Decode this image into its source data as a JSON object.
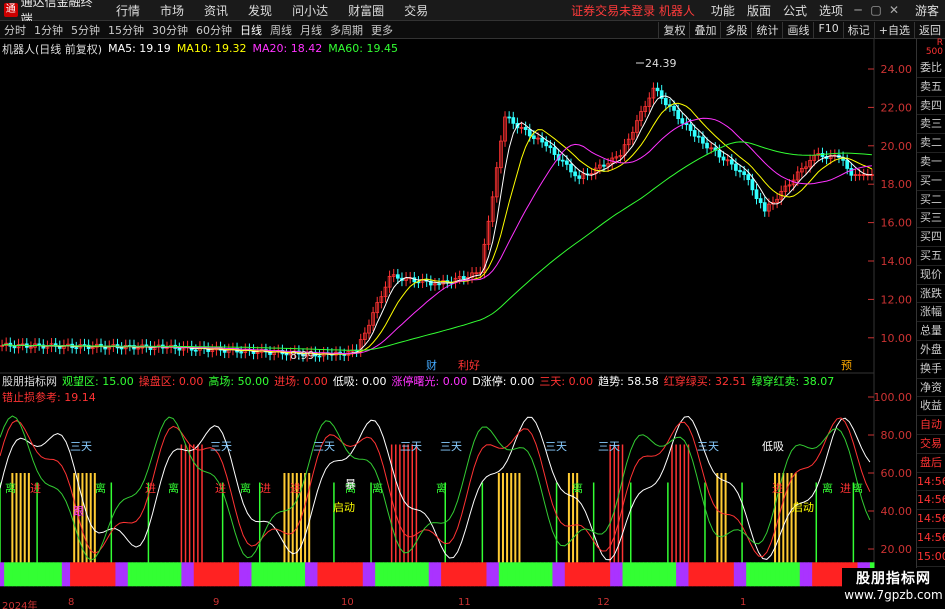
{
  "menubar": {
    "app_title": "通达信金融终端",
    "items": [
      "行情",
      "市场",
      "资讯",
      "发现",
      "问小达",
      "财富圈",
      "交易"
    ],
    "warning": "证券交易未登录  机器人",
    "right_items": [
      "功能",
      "版面",
      "公式",
      "选项"
    ],
    "guest": "游客"
  },
  "periodbar": {
    "periods": [
      "分时",
      "1分钟",
      "5分钟",
      "15分钟",
      "30分钟",
      "60分钟",
      "日线",
      "周线",
      "月线",
      "多周期",
      "更多"
    ],
    "active": "日线",
    "right_buttons": [
      "复权",
      "叠加",
      "多股",
      "统计",
      "画线",
      "F10",
      "标记",
      "+自选",
      "返回"
    ]
  },
  "stock": {
    "name": "机器人(日线 前复权)",
    "ma": [
      {
        "label": "MA5: 19.19",
        "color": "#ffffff"
      },
      {
        "label": "MA10: 19.32",
        "color": "#ffff00"
      },
      {
        "label": "MA20: 18.42",
        "color": "#ff33ff"
      },
      {
        "label": "MA60: 19.45",
        "color": "#33ff33"
      }
    ],
    "high_label": "24.39",
    "low_label": "8.99",
    "markers": [
      "财",
      "利好",
      "预"
    ]
  },
  "price_axis": [
    "24.00",
    "22.00",
    "20.00",
    "18.00",
    "16.00",
    "14.00",
    "12.00",
    "10.00"
  ],
  "indicator": {
    "name": "股朋指标网",
    "fields": [
      {
        "label": "观望区: 15.00",
        "color": "#33ff33"
      },
      {
        "label": "操盘区: 0.00",
        "color": "#ff3333"
      },
      {
        "label": "高场: 50.00",
        "color": "#33ff33"
      },
      {
        "label": "进场: 0.00",
        "color": "#ff3333"
      },
      {
        "label": "低吸: 0.00",
        "color": "#ffffff"
      },
      {
        "label": "涨停曙光: 0.00",
        "color": "#ff33ff"
      },
      {
        "label": "D涨停: 0.00",
        "color": "#ffffff"
      },
      {
        "label": "三天: 0.00",
        "color": "#ff3333"
      },
      {
        "label": "趋势: 58.58",
        "color": "#ffffff"
      },
      {
        "label": "红穿绿买: 32.51",
        "color": "#ff3333"
      },
      {
        "label": "绿穿红卖: 38.07",
        "color": "#33ff33"
      }
    ],
    "line2": "错止损参考: 19.14",
    "axis": [
      "100.00",
      "80.00",
      "60.00",
      "40.00",
      "20.00"
    ],
    "labels": {
      "santian": "三天",
      "li": "离",
      "jin": "进",
      "gen": "跟",
      "qidong": "启动",
      "bao": "暴",
      "xiji": "低吸"
    }
  },
  "sidebar": [
    "委比",
    "卖五",
    "卖四",
    "卖三",
    "卖二",
    "卖一",
    "买一",
    "买二",
    "买三",
    "买四",
    "买五",
    "现价",
    "涨跌",
    "涨幅",
    "总量",
    "外盘",
    "换手",
    "净资",
    "收益",
    "自动",
    "交易",
    "盘后",
    "14:56",
    "14:56",
    "14:56",
    "14:56",
    "15:00",
    "15:00",
    "15:11"
  ],
  "sidebar_header": "R 500",
  "xaxis": [
    {
      "label": "2024年"
    },
    {
      "label": "8"
    },
    {
      "label": "9"
    },
    {
      "label": "10"
    },
    {
      "label": "11"
    },
    {
      "label": "12"
    },
    {
      "label": "1"
    }
  ],
  "brand": {
    "name": "股朋指标网",
    "url": "www.7gpzb.com"
  },
  "colors": {
    "up": "#ff3333",
    "down": "#33ffff",
    "ma5": "#ffffff",
    "ma10": "#ffff00",
    "ma20": "#ff33ff",
    "ma60": "#33ff33"
  }
}
